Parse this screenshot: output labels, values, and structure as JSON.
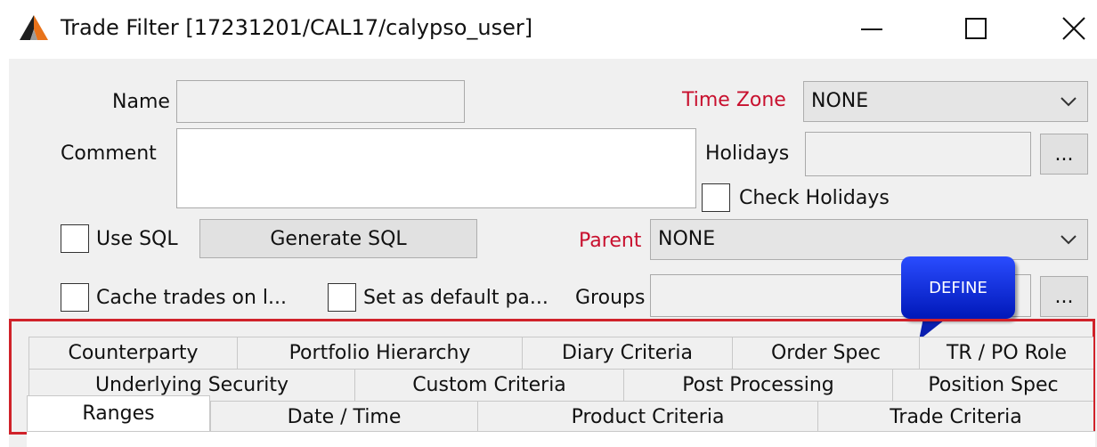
{
  "window": {
    "title": "Trade Filter [17231201/CAL17/calypso_user]",
    "minimize_glyph": "—",
    "colors": {
      "accent_red": "#c8102e",
      "define_blue": "#0a2be0",
      "highlight_red": "#d0222a"
    }
  },
  "form": {
    "name_label": "Name",
    "name_value": "",
    "comment_label": "Comment",
    "comment_value": "",
    "time_zone_label": "Time Zone",
    "time_zone_value": "NONE",
    "holidays_label": "Holidays",
    "holidays_value": "",
    "holidays_button": "...",
    "check_holidays_label": "Check Holidays",
    "use_sql_label": "Use SQL",
    "generate_sql_button": "Generate SQL",
    "parent_label": "Parent",
    "parent_value": "NONE",
    "cache_trades_label": "Cache trades on l...",
    "set_default_label": "Set as default pa...",
    "groups_label": "Groups",
    "groups_value": "",
    "groups_button": "..."
  },
  "callout": {
    "label": "DEFINE"
  },
  "tabs": {
    "row1": [
      "Counterparty",
      "Portfolio Hierarchy",
      "Diary Criteria",
      "Order Spec",
      "TR / PO Role"
    ],
    "row2": [
      "Underlying Security",
      "Custom Criteria",
      "Post Processing",
      "Position Spec"
    ],
    "row3": [
      "Ranges",
      "Date / Time",
      "Product Criteria",
      "Trade Criteria"
    ],
    "active": "Ranges"
  }
}
